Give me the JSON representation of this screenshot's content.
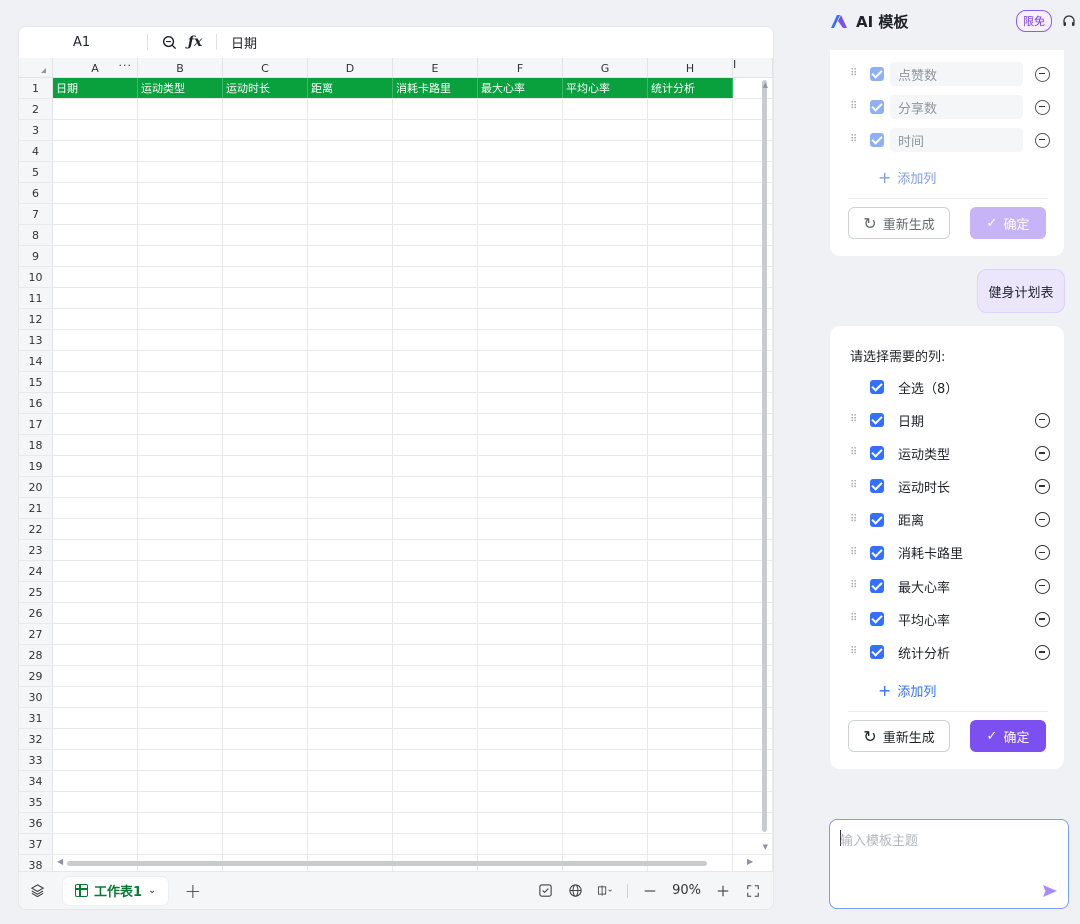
{
  "formula_bar": {
    "cell_ref": "A1",
    "value": "日期"
  },
  "columns": [
    "A",
    "B",
    "C",
    "D",
    "E",
    "F",
    "G",
    "H",
    "I"
  ],
  "header_row": [
    "日期",
    "运动类型",
    "运动时长",
    "距离",
    "消耗卡路里",
    "最大心率",
    "平均心率",
    "统计分析"
  ],
  "row_numbers": [
    "1",
    "2",
    "3",
    "4",
    "5",
    "6",
    "7",
    "8",
    "9",
    "10",
    "11",
    "12",
    "13",
    "14",
    "15",
    "16",
    "17",
    "18",
    "19",
    "20",
    "21",
    "22",
    "23",
    "24",
    "25",
    "26",
    "27",
    "28",
    "29",
    "30",
    "31",
    "32",
    "33",
    "34",
    "35",
    "36",
    "37",
    "38"
  ],
  "footer": {
    "sheet_tab": "工作表1",
    "zoom": "90%"
  },
  "panel": {
    "title": "AI 模板",
    "badge": "限免",
    "prev_card": {
      "items": [
        "点赞数",
        "分享数",
        "时间"
      ],
      "add_column": "添加列",
      "regenerate": "重新生成",
      "confirm": "确定"
    },
    "user_message": "健身计划表",
    "main_card": {
      "prompt": "请选择需要的列:",
      "select_all": "全选（8）",
      "items": [
        "日期",
        "运动类型",
        "运动时长",
        "距离",
        "消耗卡路里",
        "最大心率",
        "平均心率",
        "统计分析"
      ],
      "add_column": "添加列",
      "regenerate": "重新生成",
      "confirm": "确定"
    },
    "input": {
      "placeholder": "输入模板主题"
    }
  },
  "colors": {
    "header_green": "#09a03e",
    "accent_purple": "#7b4ff0",
    "checkbox_blue": "#3370ff"
  },
  "icons": [
    "zoom-icon",
    "fx-icon",
    "layers-icon",
    "sheet-grid-icon",
    "chevron-down-icon",
    "add-icon",
    "check-sheet-icon",
    "globe-icon",
    "freeze-icon",
    "zoom-out-icon",
    "zoom-in-icon",
    "fullscreen-icon",
    "ai-logo-icon",
    "headset-icon",
    "drag-handle-icon",
    "checkbox-icon",
    "remove-icon",
    "refresh-icon",
    "check-icon",
    "send-icon"
  ]
}
